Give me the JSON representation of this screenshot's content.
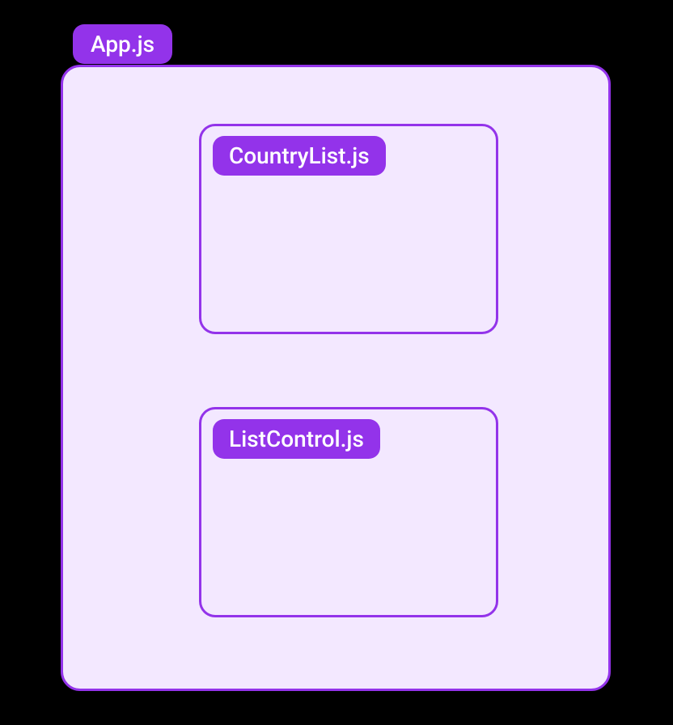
{
  "diagram": {
    "app_label": "App.js",
    "children": [
      {
        "label": "CountryList.js"
      },
      {
        "label": "ListControl.js"
      }
    ]
  }
}
